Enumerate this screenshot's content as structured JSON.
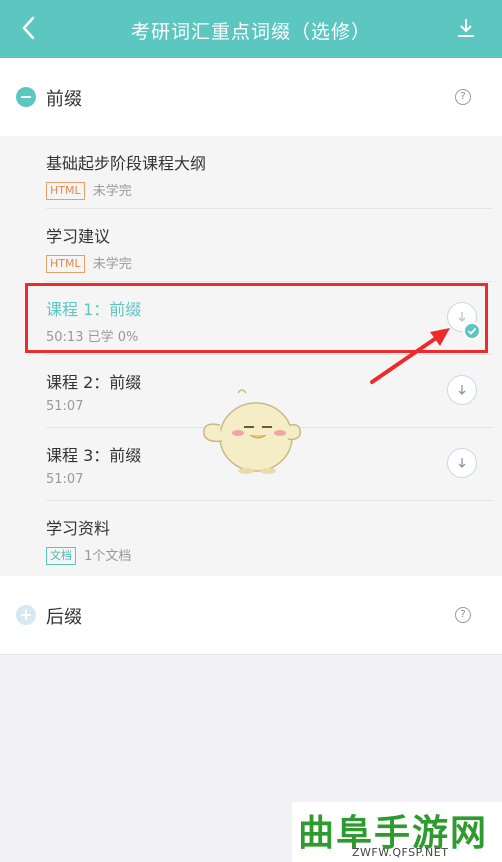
{
  "header": {
    "title": "考研词汇重点词缀（选修）"
  },
  "sections": {
    "prefix": {
      "label": "前缀",
      "help": "?"
    },
    "suffix": {
      "label": "后缀",
      "help": "?"
    }
  },
  "items": [
    {
      "name": "基础起步阶段课程大纲",
      "tag": "HTML",
      "status": "未学完"
    },
    {
      "name": "学习建议",
      "tag": "HTML",
      "status": "未学完"
    },
    {
      "name": "课程 1：前缀",
      "meta": "50:13  已学 0%"
    },
    {
      "name": "课程 2：前缀",
      "meta": "51:07"
    },
    {
      "name": "课程 3：前缀",
      "meta": "51:07"
    },
    {
      "name": "学习资料",
      "tag": "文档",
      "status": "1个文档"
    }
  ],
  "watermark": {
    "text": "曲阜手游网",
    "url": "ZWFW.QFSP.NET"
  },
  "colors": {
    "accent": "#5cc7c1",
    "highlight": "#ee2b2b",
    "tag_html": "#e08a4e"
  }
}
